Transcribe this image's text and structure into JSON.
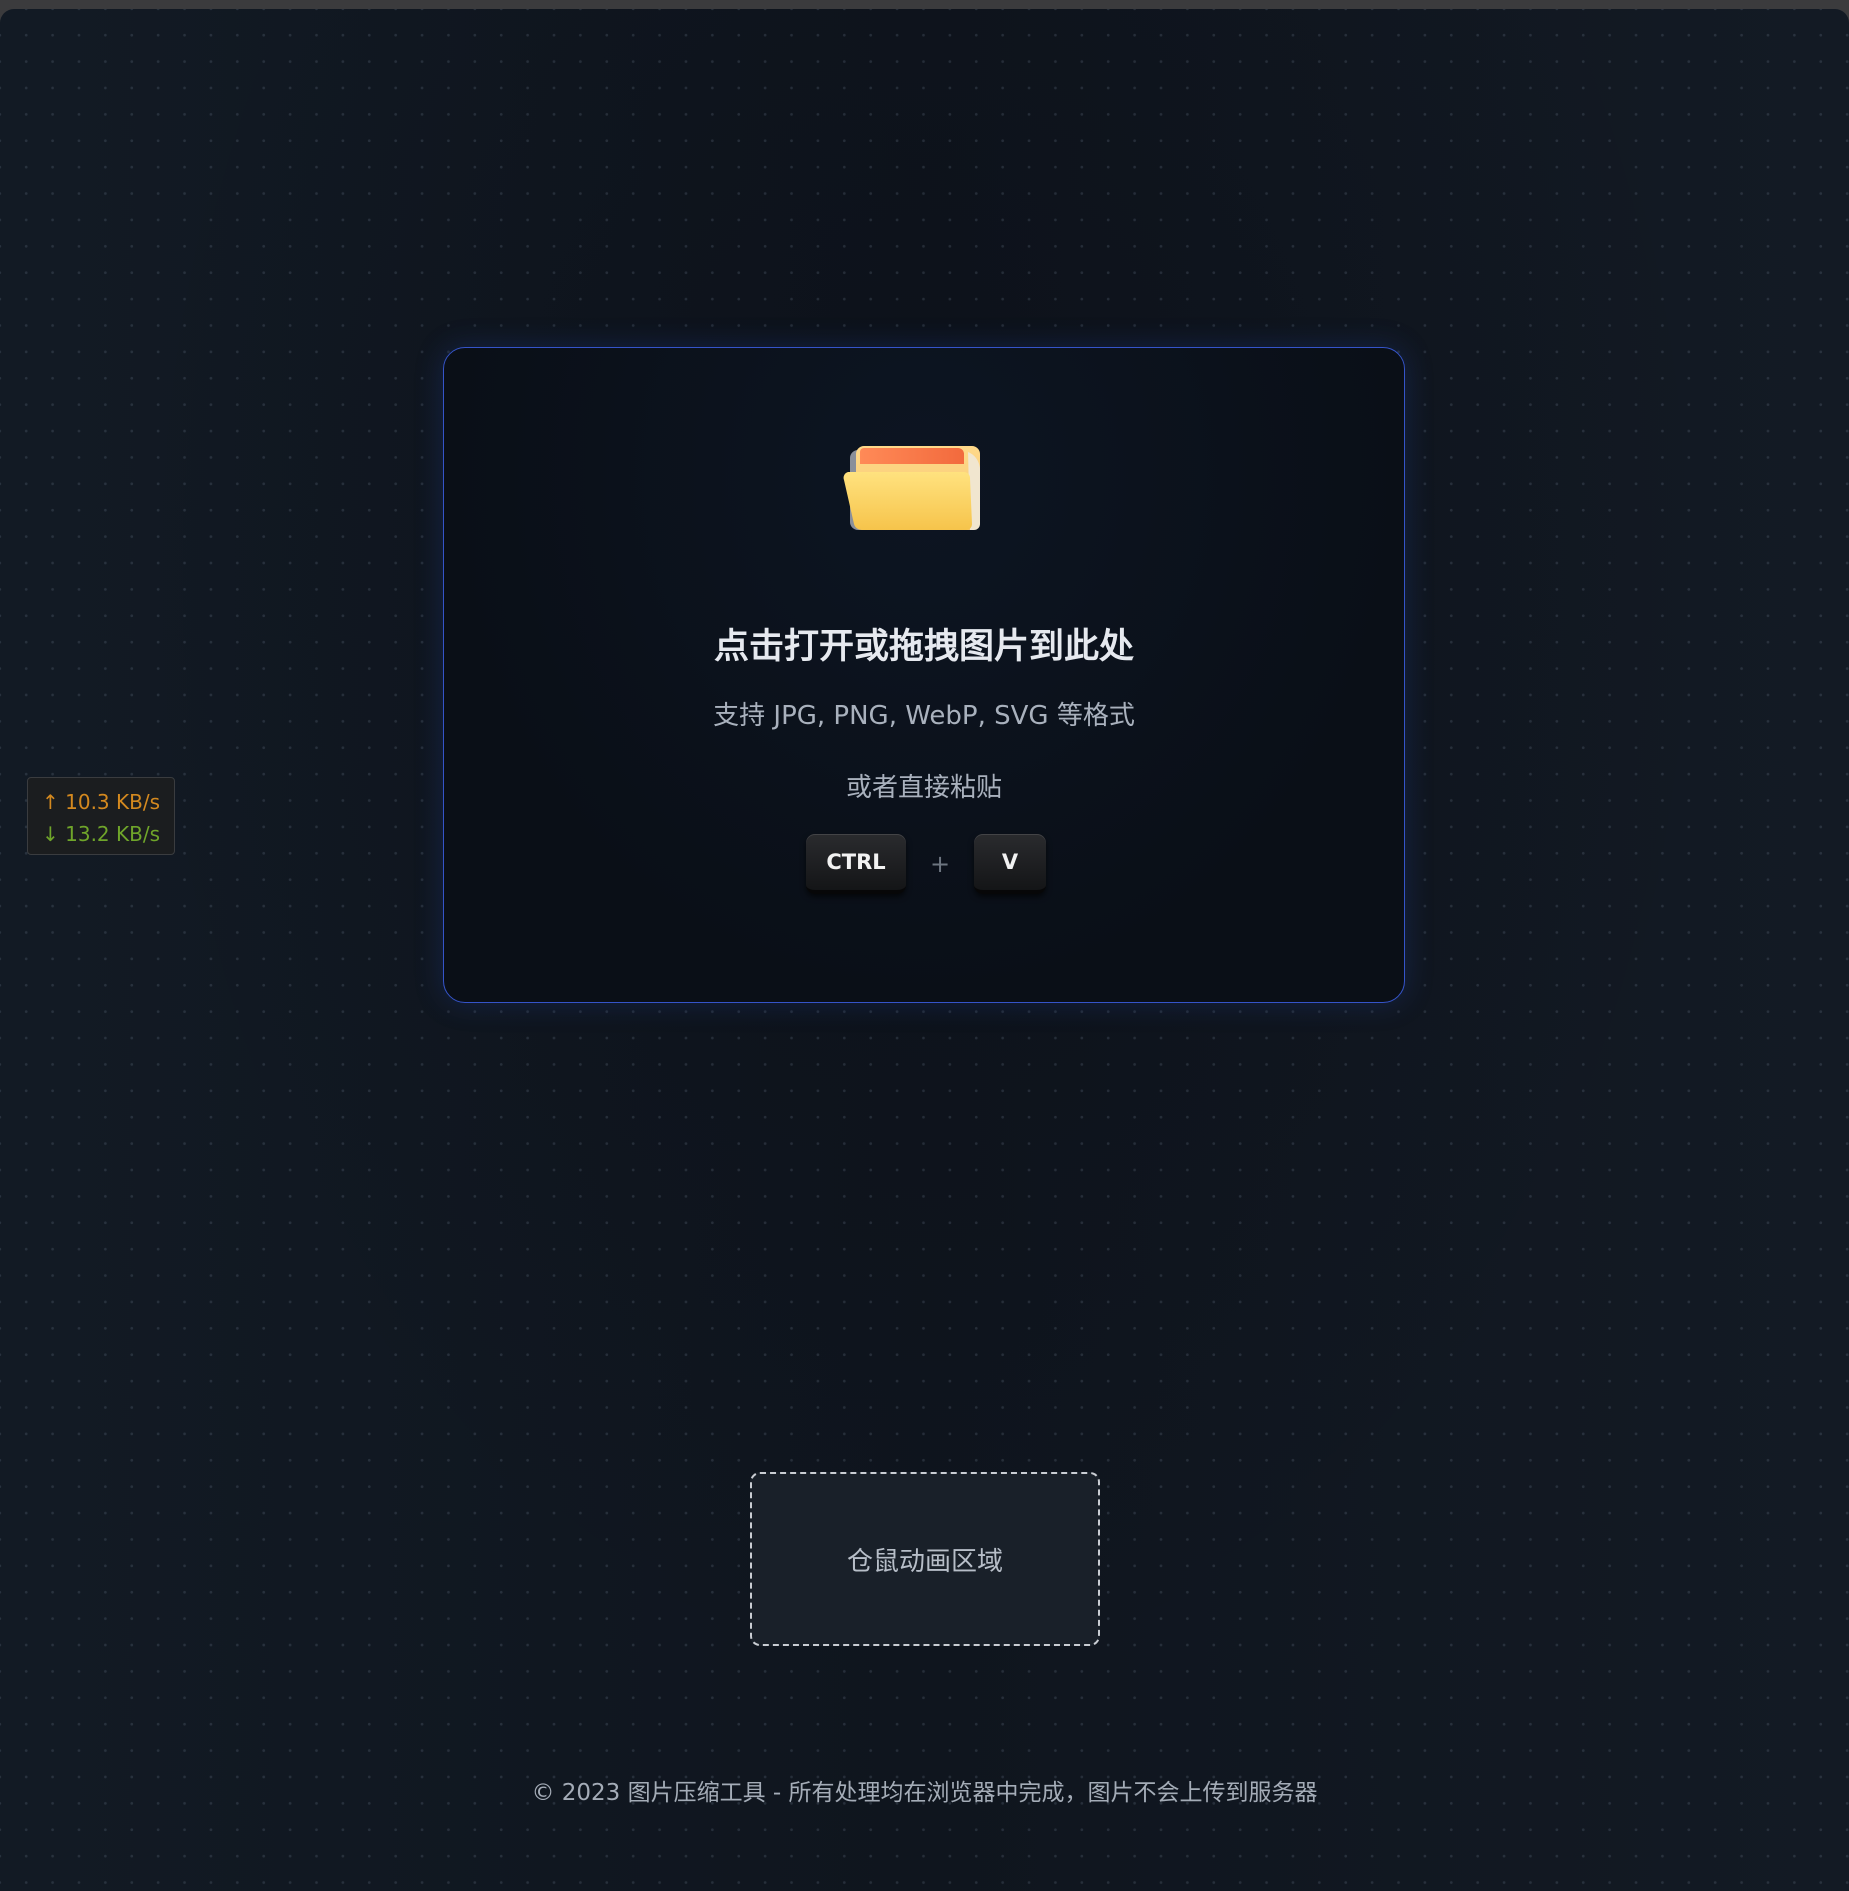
{
  "upload": {
    "icon": "open-folder-icon",
    "title": "点击打开或拖拽图片到此处",
    "formats_text": "支持 JPG, PNG, WebP, SVG 等格式",
    "paste_hint": "或者直接粘贴",
    "shortcut": {
      "key1": "CTRL",
      "plus": "+",
      "key2": "V"
    },
    "border_color": "#3554c9"
  },
  "network_speed": {
    "upload_arrow": "↑",
    "upload": "10.3 KB/s",
    "download_arrow": "↓",
    "download": "13.2 KB/s",
    "upload_color": "#d4891f",
    "download_color": "#6fa52a"
  },
  "hamster_area": {
    "label": "仓鼠动画区域"
  },
  "footer": {
    "text": "© 2023 图片压缩工具 - 所有处理均在浏览器中完成，图片不会上传到服务器"
  }
}
